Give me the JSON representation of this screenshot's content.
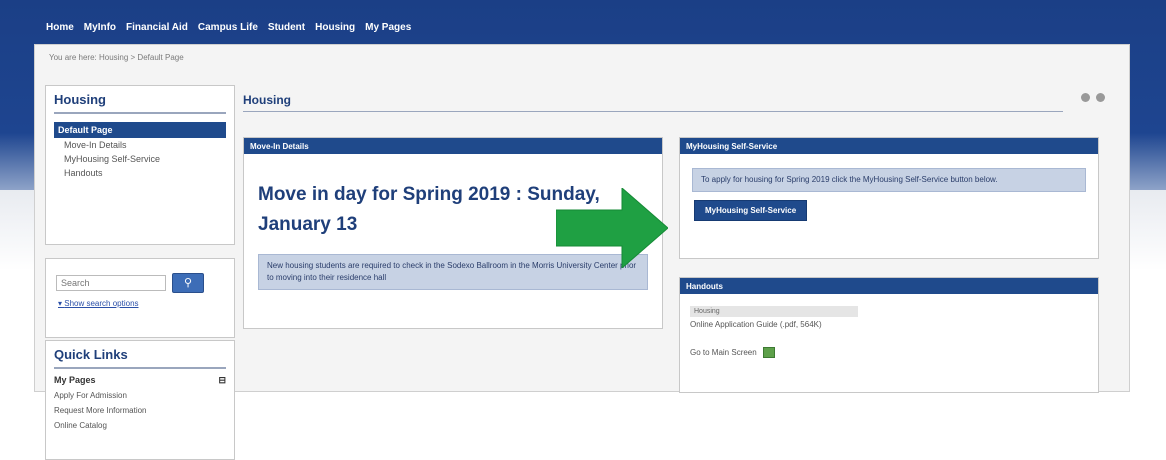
{
  "topnav": [
    "Home",
    "MyInfo",
    "Financial Aid",
    "Campus Life",
    "Student",
    "Housing",
    "My Pages"
  ],
  "breadcrumb": "You are here: Housing > Default Page",
  "housing_nav": {
    "title": "Housing",
    "active": "Default Page",
    "items": [
      "Move-In Details",
      "MyHousing Self-Service",
      "Handouts"
    ]
  },
  "search": {
    "placeholder": "Search",
    "options_link": "Show search options"
  },
  "quick_links": {
    "title": "Quick Links",
    "heading": "My Pages",
    "items": [
      "Apply For Admission",
      "Request More Information",
      "Online Catalog"
    ]
  },
  "main": {
    "title": "Housing"
  },
  "movein": {
    "header": "Move-In Details",
    "heading": "Move in day for Spring 2019 : Sunday, January 13",
    "note": "New housing students are required to check in the Sodexo Ballroom in the Morris University Center prior to moving into their residence hall"
  },
  "myhousing": {
    "header": "MyHousing Self-Service",
    "text": "To apply for housing for Spring 2019 click the MyHousing Self-Service button below.",
    "button": "MyHousing Self-Service"
  },
  "handouts": {
    "header": "Handouts",
    "label": "Housing",
    "link": "Online Application Guide (.pdf, 564K)",
    "main_screen": "Go to Main Screen"
  },
  "colors": {
    "header_blue": "#1f4a8c",
    "arrow_green": "#1fa043"
  }
}
